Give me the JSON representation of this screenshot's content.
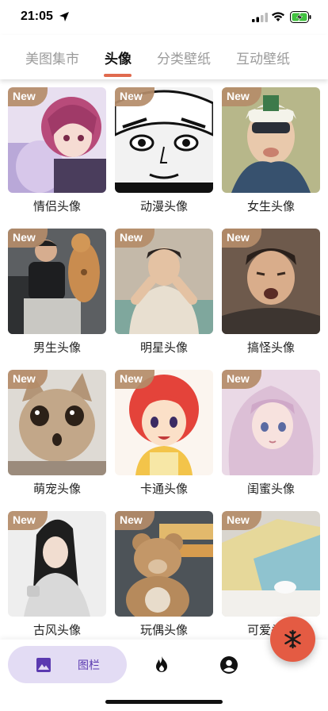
{
  "status_bar": {
    "time": "21:05"
  },
  "tabs": [
    {
      "label": "美图集市",
      "active": false
    },
    {
      "label": "头像",
      "active": true
    },
    {
      "label": "分类壁纸",
      "active": false
    },
    {
      "label": "互动壁纸",
      "active": false
    }
  ],
  "badge_text": "New",
  "cards": [
    {
      "label": "情侣头像"
    },
    {
      "label": "动漫头像"
    },
    {
      "label": "女生头像"
    },
    {
      "label": "男生头像"
    },
    {
      "label": "明星头像"
    },
    {
      "label": "搞怪头像"
    },
    {
      "label": "萌宠头像"
    },
    {
      "label": "卡通头像"
    },
    {
      "label": "闺蜜头像"
    },
    {
      "label": "古风头像"
    },
    {
      "label": "玩偶头像"
    },
    {
      "label": "可爱头像"
    }
  ],
  "bottom_nav": {
    "items": [
      {
        "icon": "gallery-icon",
        "label": "图栏",
        "active": true
      },
      {
        "icon": "fire-icon",
        "label": "",
        "active": false
      },
      {
        "icon": "account-icon",
        "label": "",
        "active": false
      }
    ]
  },
  "fab": {
    "icon": "snowflake-icon"
  },
  "colors": {
    "accent": "#e06a4e",
    "fab": "#e45b43",
    "nav_pill": "#e3dcf4",
    "nav_pill_text": "#5b3ab0",
    "badge": "#b48c69"
  }
}
